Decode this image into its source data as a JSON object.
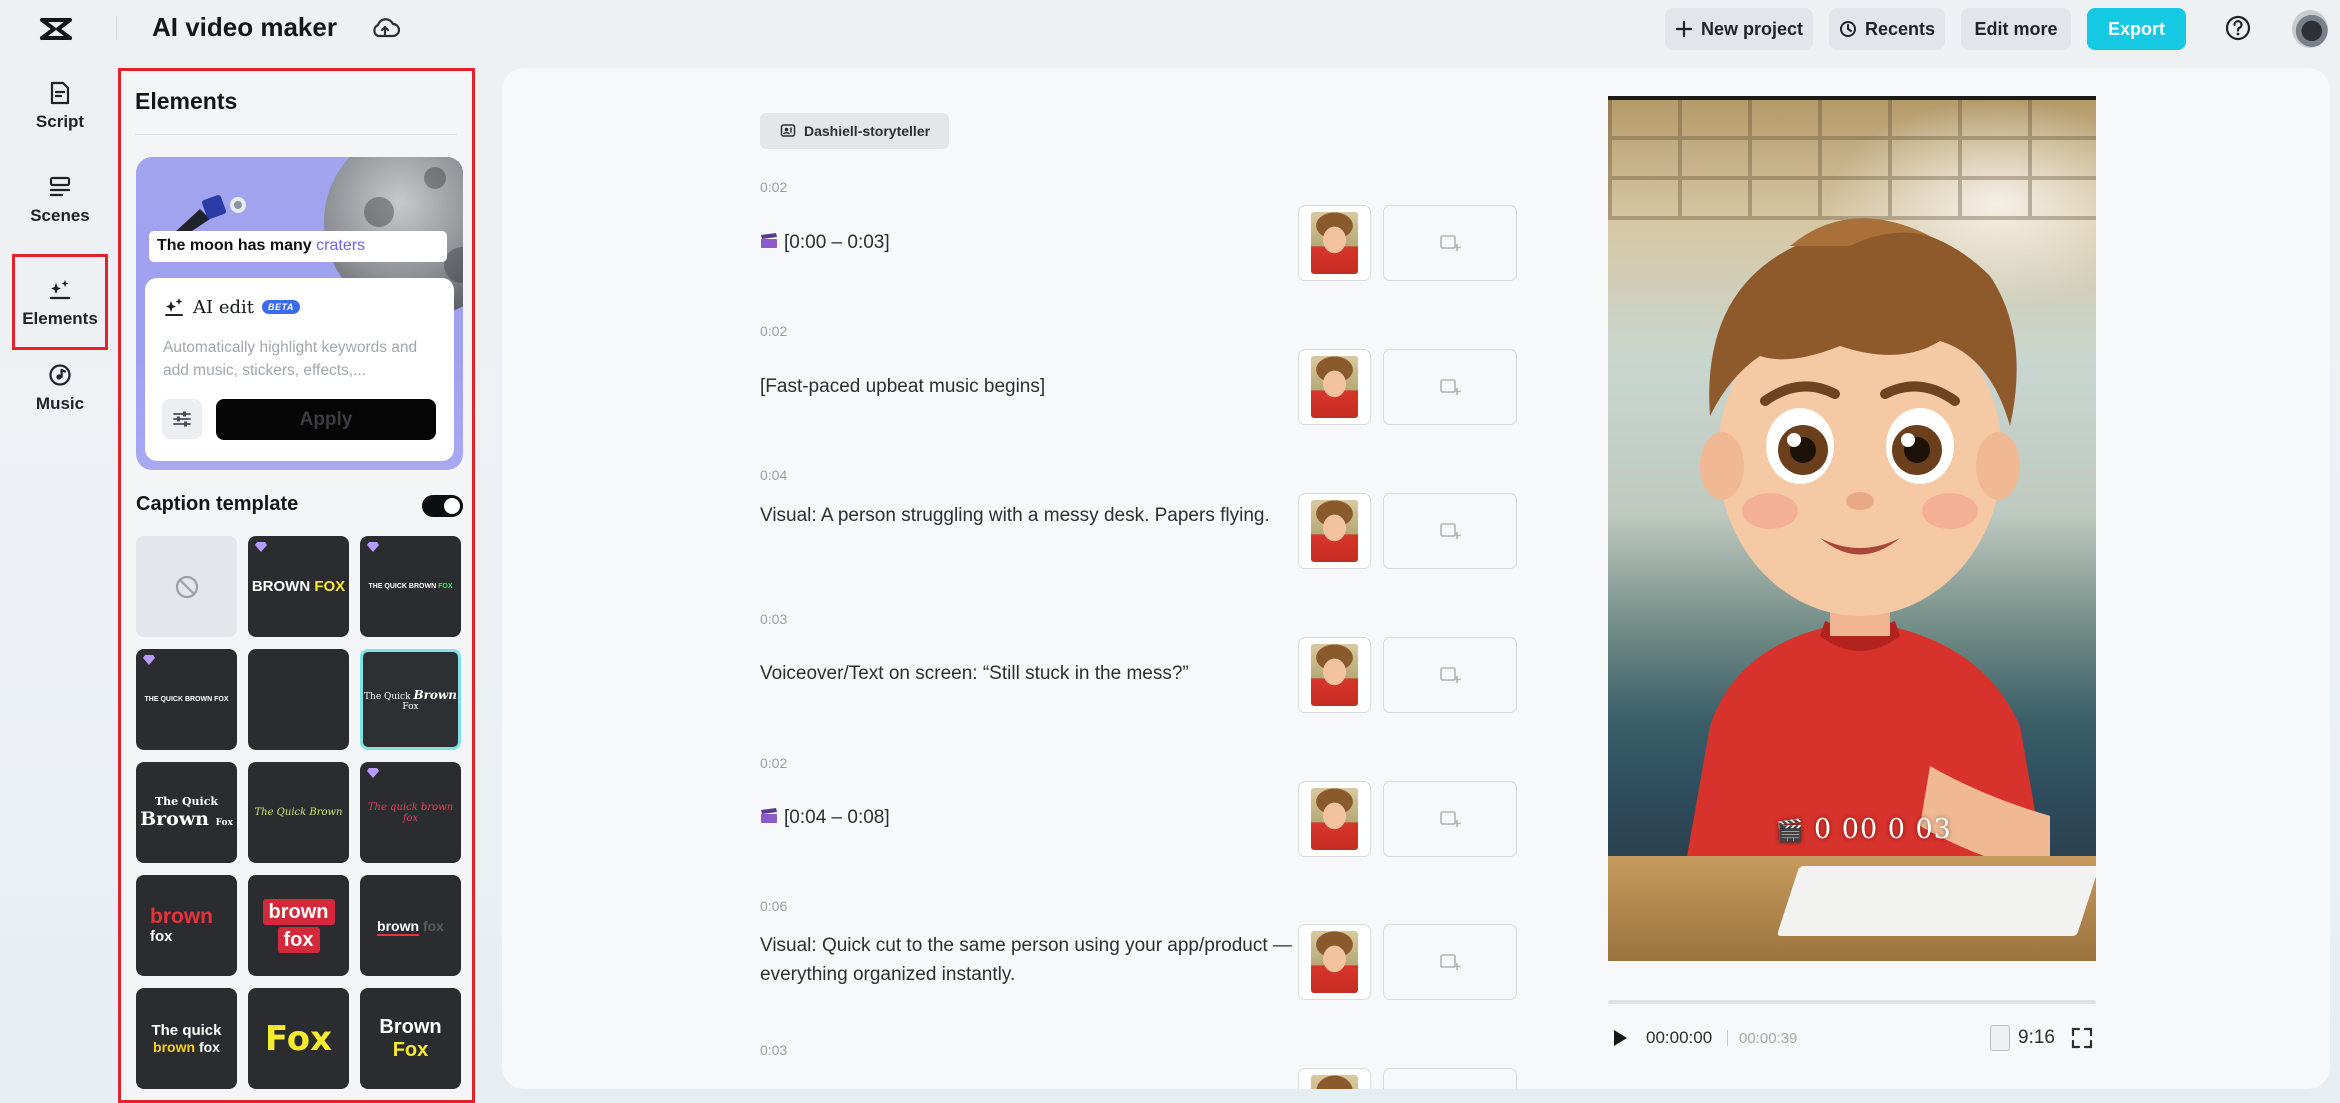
{
  "header": {
    "app_title": "AI video maker",
    "new_project_label": "New project",
    "recents_label": "Recents",
    "edit_more_label": "Edit more",
    "export_label": "Export",
    "accent_color": "#16c9e3"
  },
  "sidebar": {
    "items": [
      {
        "label": "Script",
        "icon": "script-icon"
      },
      {
        "label": "Scenes",
        "icon": "scenes-icon"
      },
      {
        "label": "Elements",
        "icon": "elements-icon",
        "active": true
      },
      {
        "label": "Music",
        "icon": "music-icon"
      }
    ]
  },
  "elements_panel": {
    "title": "Elements",
    "ai_card": {
      "caption_prefix": "The moon has many",
      "caption_keyword": "craters",
      "ai_edit_label": "AI edit",
      "beta_badge": "BETA",
      "description": "Automatically highlight keywords and add music, stickers, effects,...",
      "apply_label": "Apply"
    },
    "caption_template": {
      "label": "Caption template",
      "enabled": true,
      "templates": [
        {
          "name": "none"
        },
        {
          "text_a": "BROWN",
          "text_b": "FOX",
          "premium": true
        },
        {
          "text_a": "THE QUICK BROWN",
          "text_b": "FOX",
          "premium": true
        },
        {
          "text_a": "THE QUICK BROWN FOX",
          "premium": true
        },
        {
          "text_a": ""
        },
        {
          "text_a": "The Quick",
          "text_b": "Brown",
          "text_c": "Fox",
          "selected": true
        },
        {
          "text_a": "The Quick",
          "text_b": "Brown",
          "text_c": "Fox"
        },
        {
          "text_a": "The Quick Brown"
        },
        {
          "text_a": "The quick brown fox",
          "premium": true
        },
        {
          "text_a": "brown",
          "text_b": "fox"
        },
        {
          "text_a": "brown",
          "text_b": "fox"
        },
        {
          "text_a": "brown",
          "text_b": "fox"
        },
        {
          "text_a": "The quick",
          "text_b": "brown",
          "text_c": "fox"
        },
        {
          "text_a": "Fox"
        },
        {
          "text_a": "Brown",
          "text_b": "Fox"
        }
      ]
    }
  },
  "script": {
    "voice": "Dashiell-storyteller",
    "lines": [
      {
        "duration": "0:02",
        "text": "[0:00 – 0:03]",
        "scene_marker": true
      },
      {
        "duration": "0:02",
        "text": "[Fast-paced upbeat music begins]"
      },
      {
        "duration": "0:04",
        "text": "Visual: A person struggling with a messy desk. Papers flying."
      },
      {
        "duration": "0:03",
        "text": "Voiceover/Text on screen: “Still stuck in the mess?”"
      },
      {
        "duration": "0:02",
        "text": "[0:04 – 0:08]",
        "scene_marker": true
      },
      {
        "duration": "0:06",
        "text": "Visual: Quick cut to the same person using your app/product — everything organized instantly."
      },
      {
        "duration": "0:03",
        "text": ""
      }
    ]
  },
  "preview": {
    "caption": "0 00 0 03",
    "current_time": "00:00:00",
    "total_time": "00:00:39",
    "aspect_ratio": "9:16",
    "progress": 0
  }
}
